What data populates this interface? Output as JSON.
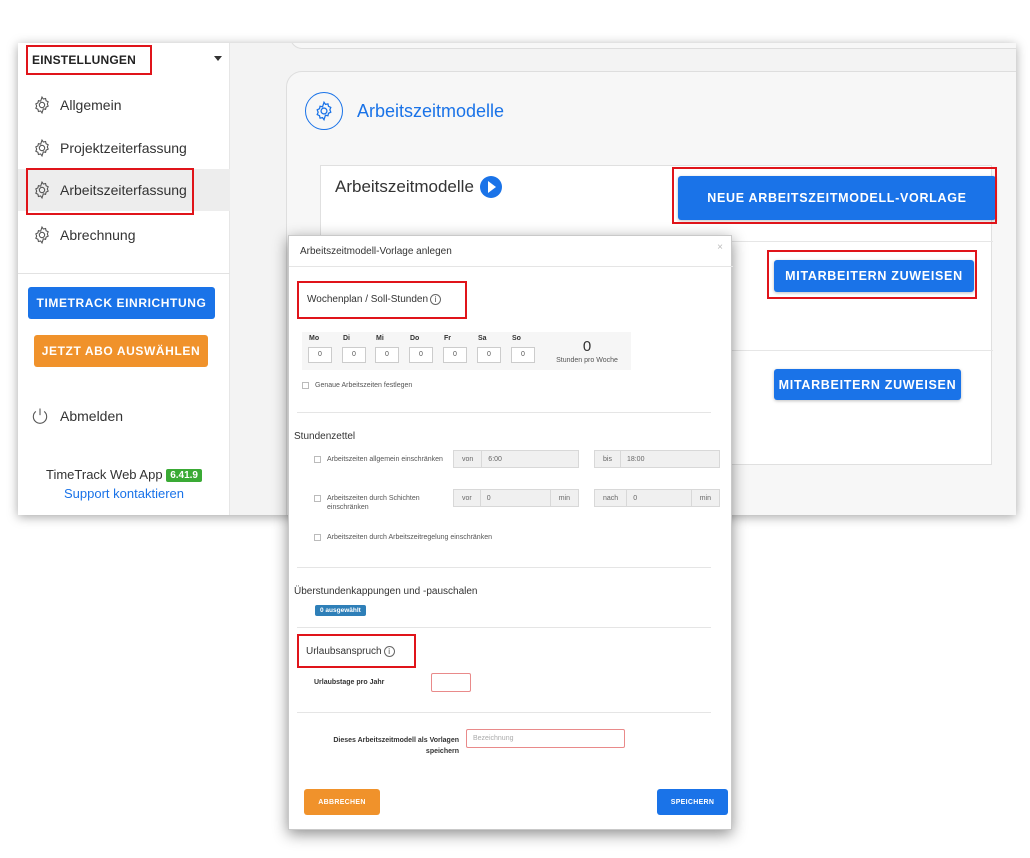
{
  "sidebar": {
    "header": "EINSTELLUNGEN",
    "items": [
      {
        "label": "Allgemein"
      },
      {
        "label": "Projektzeiterfassung"
      },
      {
        "label": "Arbeitszeiterfassung"
      },
      {
        "label": "Abrechnung"
      }
    ],
    "setup_button": "TIMETRACK EINRICHTUNG",
    "abo_button": "JETZT ABO AUSWÄHLEN",
    "logout": "Abmelden",
    "app_name": "TimeTrack Web App",
    "version": "6.41.9",
    "support": "Support kontaktieren"
  },
  "main": {
    "card_title": "Arbeitszeitmodelle",
    "panel_title": "Arbeitszeitmodelle",
    "new_template_button": "NEUE ARBEITSZEITMODELL-VORLAGE",
    "assign_button_1": "MITARBEITERN ZUWEISEN",
    "assign_button_2": "MITARBEITERN ZUWEISEN"
  },
  "modal": {
    "title": "Arbeitszeitmodell-Vorlage anlegen",
    "close": "×",
    "weekplan_heading": "Wochenplan / Soll-Stunden",
    "info": "i",
    "days": [
      {
        "label": "Mo",
        "value": "0"
      },
      {
        "label": "Di",
        "value": "0"
      },
      {
        "label": "Mi",
        "value": "0"
      },
      {
        "label": "Do",
        "value": "0"
      },
      {
        "label": "Fr",
        "value": "0"
      },
      {
        "label": "Sa",
        "value": "0"
      },
      {
        "label": "So",
        "value": "0"
      }
    ],
    "total_hours": "0",
    "total_label": "Stunden pro Woche",
    "exact_times": "Genaue Arbeitszeiten festlegen",
    "timesheet_heading": "Stundenzettel",
    "restrict_general": "Arbeitszeiten allgemein einschränken",
    "von_label": "von",
    "von_value": "6:00",
    "bis_label": "bis",
    "bis_value": "18:00",
    "restrict_shifts": "Arbeitszeiten durch Schichten einschränken",
    "vor_label": "vor",
    "vor_value": "0",
    "nach_label": "nach",
    "nach_value": "0",
    "min_label": "min",
    "restrict_rules": "Arbeitszeiten durch Arbeitszeitregelung einschränken",
    "overtime_heading": "Überstundenkappungen und -pauschalen",
    "selected_badge": "0 ausgewählt",
    "vacation_heading": "Urlaubsanspruch",
    "vacation_days_label": "Urlaubstage pro Jahr",
    "save_as_template_label": "Dieses Arbeitszeitmodell als Vorlagen speichern",
    "name_placeholder": "Bezeichnung",
    "cancel_button": "ABBRECHEN",
    "save_button": "SPEICHERN"
  },
  "colors": {
    "primary": "#1a73e8",
    "orange": "#f0922b",
    "highlight": "#e0141a",
    "version_badge": "#3aaa35"
  }
}
